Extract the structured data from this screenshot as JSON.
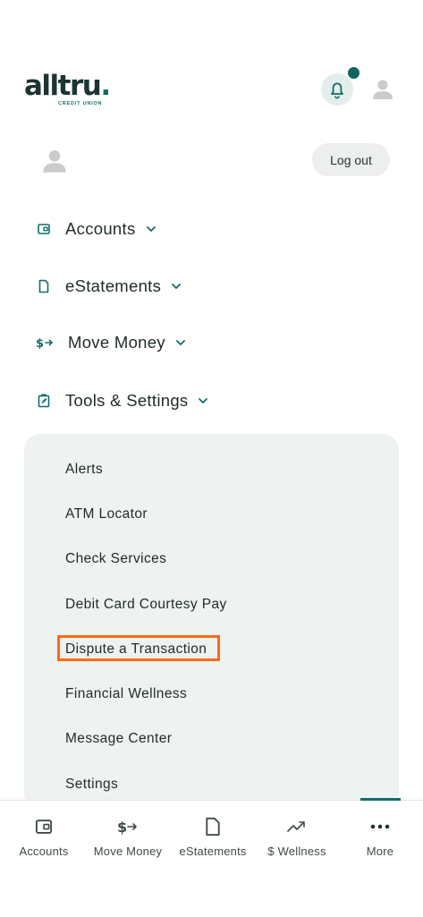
{
  "header": {
    "logo_text": "alltru",
    "logo_dot": ".",
    "logo_subtext": "CREDIT UNION",
    "notification_dot": true
  },
  "user": {
    "logout_label": "Log out"
  },
  "nav": {
    "items": [
      {
        "label": "Accounts",
        "icon": "wallet-icon"
      },
      {
        "label": "eStatements",
        "icon": "document-icon"
      },
      {
        "label": "Move Money",
        "icon": "transfer-money-icon"
      },
      {
        "label": "Tools & Settings",
        "icon": "clipboard-edit-icon"
      }
    ]
  },
  "submenu": {
    "items": [
      "Alerts",
      "ATM Locator",
      "Check Services",
      "Debit Card Courtesy Pay",
      "Dispute a Transaction",
      "Financial Wellness",
      "Message Center",
      "Settings"
    ],
    "highlighted": "Dispute a Transaction"
  },
  "bottom_nav": {
    "tabs": [
      {
        "label": "Accounts",
        "icon": "wallet-icon"
      },
      {
        "label": "Move Money",
        "icon": "transfer-money-icon"
      },
      {
        "label": "eStatements",
        "icon": "document-icon"
      },
      {
        "label": "$ Wellness",
        "icon": "trending-up-icon"
      },
      {
        "label": "More",
        "icon": "more-dots-icon"
      }
    ],
    "active": "More"
  },
  "colors": {
    "brand_dark": "#1d3433",
    "brand_teal": "#0f6e68",
    "highlight": "#ff6a13",
    "submenu_bg": "#eef2f1"
  }
}
